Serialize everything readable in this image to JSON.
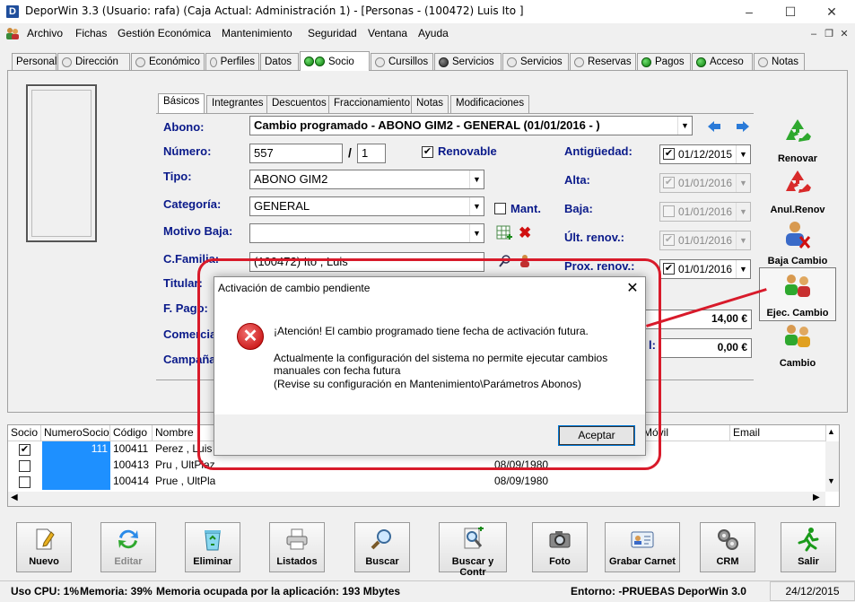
{
  "window": {
    "app_icon": "D",
    "title": "DeporWin 3.3  (Usuario: rafa)  (Caja Actual: Administración 1) - [Personas - (100472) Luis Ito ]",
    "minimize": "–",
    "maximize": "☐",
    "close": "✕"
  },
  "menu": {
    "items": [
      "Archivo",
      "Fichas",
      "Gestión Económica",
      "Mantenimiento",
      "Seguridad",
      "Ventana",
      "Ayuda"
    ],
    "mdi_min": "–",
    "mdi_restore": "❐",
    "mdi_close": "✕"
  },
  "top_tabs": [
    {
      "label": "Personal",
      "dot": "none"
    },
    {
      "label": "Dirección",
      "dot": "grey"
    },
    {
      "label": "Económico",
      "dot": "grey"
    },
    {
      "label": "Perfiles",
      "dot": "grey"
    },
    {
      "label": "Datos",
      "dot": "none"
    },
    {
      "label": "Socio",
      "dot": "green"
    },
    {
      "label": "Cursillos",
      "dot": "grey"
    },
    {
      "label": "Servicios",
      "dot": "dark"
    },
    {
      "label": "Servicios",
      "dot": "grey"
    },
    {
      "label": "Reservas",
      "dot": "grey"
    },
    {
      "label": "Pagos",
      "dot": "green"
    },
    {
      "label": "Acceso",
      "dot": "green"
    },
    {
      "label": "Notas",
      "dot": "grey"
    }
  ],
  "inner_tabs": [
    "Básicos",
    "Integrantes",
    "Descuentos",
    "Fraccionamiento",
    "Notas",
    "Modificaciones"
  ],
  "form": {
    "abono_label": "Abono:",
    "abono_value": "Cambio programado - ABONO GIM2 - GENERAL (01/01/2016 - )",
    "numero_label": "Número:",
    "numero_value": "557",
    "numero_sep": "/",
    "numero_sub": "1",
    "renovable_label": "Renovable",
    "renovable_checked": true,
    "tipo_label": "Tipo:",
    "tipo_value": "ABONO GIM2",
    "categoria_label": "Categoría:",
    "categoria_value": "GENERAL",
    "mant_label": "Mant.",
    "motivo_label": "Motivo Baja:",
    "motivo_value": "",
    "cfamilia_label": "C.Familia:",
    "cfamilia_value": "(100472) Ito , Luis",
    "titular_label": "Titular:",
    "fpago_label": "F. Pago:",
    "comercial_label": "Comercial:",
    "campana_label": "Campaña:",
    "antiguedad_label": "Antigüedad:",
    "antiguedad_value": "01/12/2015",
    "alta_label": "Alta:",
    "alta_value": "01/01/2016",
    "baja_label": "Baja:",
    "baja_value": "01/01/2016",
    "ult_renov_label": "Últ. renov.:",
    "ult_renov_value": "01/01/2016",
    "prox_renov_label": "Prox. renov.:",
    "prox_renov_value": "01/01/2016",
    "importe1": "14,00 €",
    "importe2_label": "l:",
    "importe2": "0,00 €"
  },
  "side_buttons": [
    {
      "label": "Renovar",
      "icon": "recycle-green-icon"
    },
    {
      "label": "Anul.Renov",
      "icon": "recycle-red-icon"
    },
    {
      "label": "Baja Cambio",
      "icon": "user-remove-icon"
    },
    {
      "label": "Ejec. Cambio",
      "icon": "users-exchange-icon"
    },
    {
      "label": "Cambio",
      "icon": "users-icon"
    }
  ],
  "grid": {
    "headers": [
      "Socio",
      "NumeroSocio",
      "Código",
      "Nombre",
      "Móvil",
      "Email"
    ],
    "rows": [
      {
        "checked": true,
        "numero": "111",
        "codigo": "100411",
        "nombre": "Perez , Luis",
        "fecha": ""
      },
      {
        "checked": false,
        "numero": "",
        "codigo": "100413",
        "nombre": "Pru , UltPlaz",
        "fecha": "08/09/1980"
      },
      {
        "checked": false,
        "numero": "",
        "codigo": "100414",
        "nombre": "Prue , UltPlaz",
        "fecha": "08/09/1980"
      }
    ]
  },
  "toolbar": [
    {
      "label": "Nuevo",
      "icon": "new-document-icon",
      "enabled": true
    },
    {
      "label": "Editar",
      "icon": "edit-refresh-icon",
      "enabled": false
    },
    {
      "label": "Eliminar",
      "icon": "recycle-bin-icon",
      "enabled": true
    },
    {
      "label": "Listados",
      "icon": "printer-icon",
      "enabled": true
    },
    {
      "label": "Buscar",
      "icon": "magnifier-icon",
      "enabled": true
    },
    {
      "label": "Buscar y Contr",
      "icon": "search-document-icon",
      "enabled": true
    },
    {
      "label": "Foto",
      "icon": "camera-icon",
      "enabled": true
    },
    {
      "label": "Grabar Carnet",
      "icon": "id-card-icon",
      "enabled": true
    },
    {
      "label": "CRM",
      "icon": "crm-gears-icon",
      "enabled": true
    },
    {
      "label": "Salir",
      "icon": "running-man-icon",
      "enabled": true
    }
  ],
  "status": {
    "cpu": "Uso CPU: 1%",
    "mem": "Memoria: 39%",
    "app_mem": "Memoria ocupada por la aplicación: 193 Mbytes",
    "env": "Entorno: -PRUEBAS DeporWin 3.0",
    "date": "24/12/2015"
  },
  "dialog": {
    "title": "Activación de cambio pendiente",
    "close": "✕",
    "icon": "error-icon",
    "line1": "¡Atención! El cambio programado tiene fecha de activación futura.",
    "line2": "Actualmente la configuración del sistema no permite ejecutar cambios",
    "line3": "manuales con fecha futura",
    "line4": "(Revise su configuración en Mantenimiento\\Parámetros Abonos)",
    "ok": "Aceptar"
  },
  "colors": {
    "label_blue": "#0a1a8a",
    "annotation_red": "#d81a2a",
    "grid_blue": "#1e90ff"
  }
}
